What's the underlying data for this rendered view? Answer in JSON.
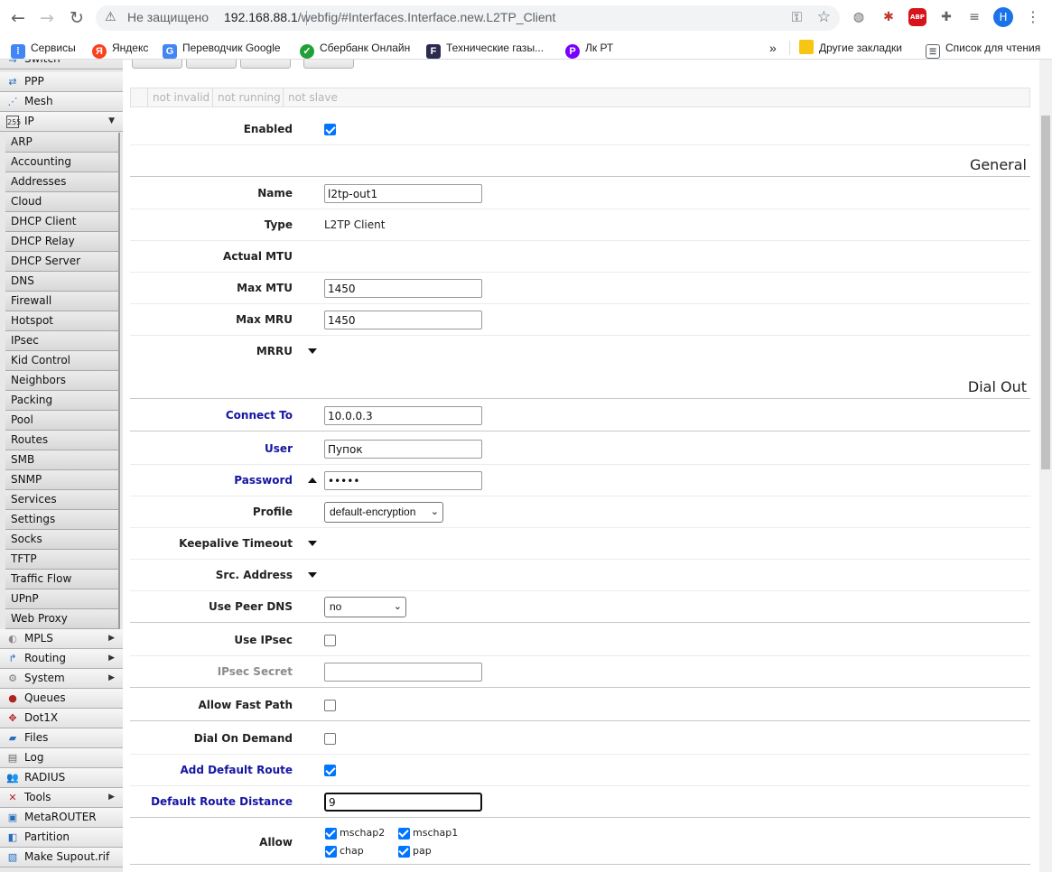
{
  "browser": {
    "security_label": "Не защищено",
    "url_host": "192.168.88.1",
    "url_path": "/webfig/#Interfaces.Interface.new.L2TP_Client",
    "profile_initial": "H",
    "adblock_label": "ABP"
  },
  "bookmarks": [
    {
      "label": "Сервисы",
      "icon": "apps-grid-icon",
      "color": "#4285f4"
    },
    {
      "label": "Яндекс",
      "icon": "yandex-icon",
      "color": "#fc3f1d"
    },
    {
      "label": "Переводчик Google",
      "icon": "google-translate-icon",
      "color": "#4285f4"
    },
    {
      "label": "Сбербанк Онлайн",
      "icon": "sberbank-icon",
      "color": "#21a038"
    },
    {
      "label": "Технические газы...",
      "icon": "site-f-icon",
      "color": "#2b2b50"
    },
    {
      "label": "Лк РТ",
      "icon": "rt-icon",
      "color": "#7700ff"
    },
    {
      "label": "Другие закладки",
      "icon": "folder-icon",
      "color": "#f9c513"
    },
    {
      "label": "Список для чтения",
      "icon": "reading-list-icon",
      "color": "#5f6368"
    }
  ],
  "sidebar": {
    "top_items": [
      {
        "label": "Switch",
        "icon": "switch-icon"
      },
      {
        "label": "PPP",
        "icon": "ppp-icon"
      },
      {
        "label": "Mesh",
        "icon": "mesh-icon"
      },
      {
        "label": "IP",
        "icon": "ip-icon",
        "arrow": "▼"
      }
    ],
    "ip_submenu": [
      "ARP",
      "Accounting",
      "Addresses",
      "Cloud",
      "DHCP Client",
      "DHCP Relay",
      "DHCP Server",
      "DNS",
      "Firewall",
      "Hotspot",
      "IPsec",
      "Kid Control",
      "Neighbors",
      "Packing",
      "Pool",
      "Routes",
      "SMB",
      "SNMP",
      "Services",
      "Settings",
      "Socks",
      "TFTP",
      "Traffic Flow",
      "UPnP",
      "Web Proxy"
    ],
    "bottom_items": [
      {
        "label": "MPLS",
        "icon": "mpls-icon",
        "arrow": "▶"
      },
      {
        "label": "Routing",
        "icon": "routing-icon",
        "arrow": "▶"
      },
      {
        "label": "System",
        "icon": "system-gear-icon",
        "arrow": "▶"
      },
      {
        "label": "Queues",
        "icon": "queues-icon"
      },
      {
        "label": "Dot1X",
        "icon": "dot1x-icon"
      },
      {
        "label": "Files",
        "icon": "files-icon"
      },
      {
        "label": "Log",
        "icon": "log-icon"
      },
      {
        "label": "RADIUS",
        "icon": "radius-icon"
      },
      {
        "label": "Tools",
        "icon": "tools-icon",
        "arrow": "▶"
      },
      {
        "label": "MetaROUTER",
        "icon": "metarouter-icon"
      },
      {
        "label": "Partition",
        "icon": "partition-icon"
      },
      {
        "label": "Make Supout.rif",
        "icon": "supout-icon"
      }
    ]
  },
  "status": [
    "not invalid",
    "not running",
    "not slave"
  ],
  "form": {
    "enabled": {
      "label": "Enabled",
      "checked": true
    },
    "section_general": "General",
    "name": {
      "label": "Name",
      "value": "l2tp-out1"
    },
    "type": {
      "label": "Type",
      "value": "L2TP Client"
    },
    "actual_mtu": {
      "label": "Actual MTU"
    },
    "max_mtu": {
      "label": "Max MTU",
      "value": "1450"
    },
    "max_mru": {
      "label": "Max MRU",
      "value": "1450"
    },
    "mrru": {
      "label": "MRRU"
    },
    "section_dial_out": "Dial Out",
    "connect_to": {
      "label": "Connect To",
      "value": "10.0.0.3"
    },
    "user": {
      "label": "User",
      "value": "Пупок"
    },
    "password": {
      "label": "Password",
      "value": "•••••"
    },
    "profile": {
      "label": "Profile",
      "value": "default-encryption"
    },
    "keepalive_timeout": {
      "label": "Keepalive Timeout"
    },
    "src_address": {
      "label": "Src. Address"
    },
    "use_peer_dns": {
      "label": "Use Peer DNS",
      "value": "no"
    },
    "use_ipsec": {
      "label": "Use IPsec",
      "checked": false
    },
    "ipsec_secret": {
      "label": "IPsec Secret",
      "value": ""
    },
    "allow_fast_path": {
      "label": "Allow Fast Path",
      "checked": false
    },
    "dial_on_demand": {
      "label": "Dial On Demand",
      "checked": false
    },
    "add_default_route": {
      "label": "Add Default Route",
      "checked": true
    },
    "default_route_distance": {
      "label": "Default Route Distance",
      "value": "9"
    },
    "allow": {
      "label": "Allow",
      "options": [
        "mschap2",
        "mschap1",
        "chap",
        "pap"
      ]
    }
  },
  "colors": {
    "checkbox_blue": "#0075ff",
    "label_blue": "#1515a3"
  }
}
